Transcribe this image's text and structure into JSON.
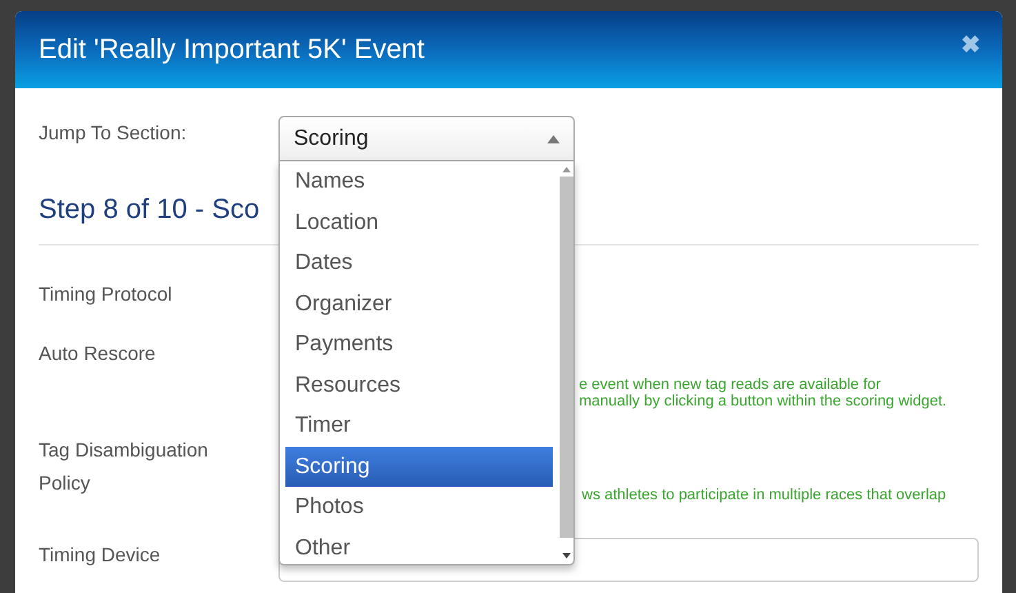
{
  "modal": {
    "title": "Edit 'Really Important 5K' Event",
    "close": "✖"
  },
  "jump": {
    "label": "Jump To Section:",
    "value": "Scoring",
    "expanded": true,
    "options": [
      {
        "label": "Names",
        "selected": false
      },
      {
        "label": "Location",
        "selected": false
      },
      {
        "label": "Dates",
        "selected": false
      },
      {
        "label": "Organizer",
        "selected": false
      },
      {
        "label": "Payments",
        "selected": false
      },
      {
        "label": "Resources",
        "selected": false
      },
      {
        "label": "Timer",
        "selected": false
      },
      {
        "label": "Scoring",
        "selected": true
      },
      {
        "label": "Photos",
        "selected": false
      },
      {
        "label": "Other",
        "selected": false
      }
    ]
  },
  "step_heading": "Step 8 of 10 - Sco",
  "fields": [
    {
      "label": "Timing Protocol"
    },
    {
      "label": "Auto Rescore",
      "help": [
        "e event when new tag reads are available for",
        "manually by clicking a button within the scoring widget."
      ]
    },
    {
      "label": "Tag Disambiguation Policy",
      "help": [
        "ws athletes to participate in multiple races that overlap"
      ]
    },
    {
      "label": "Timing Device"
    }
  ]
}
